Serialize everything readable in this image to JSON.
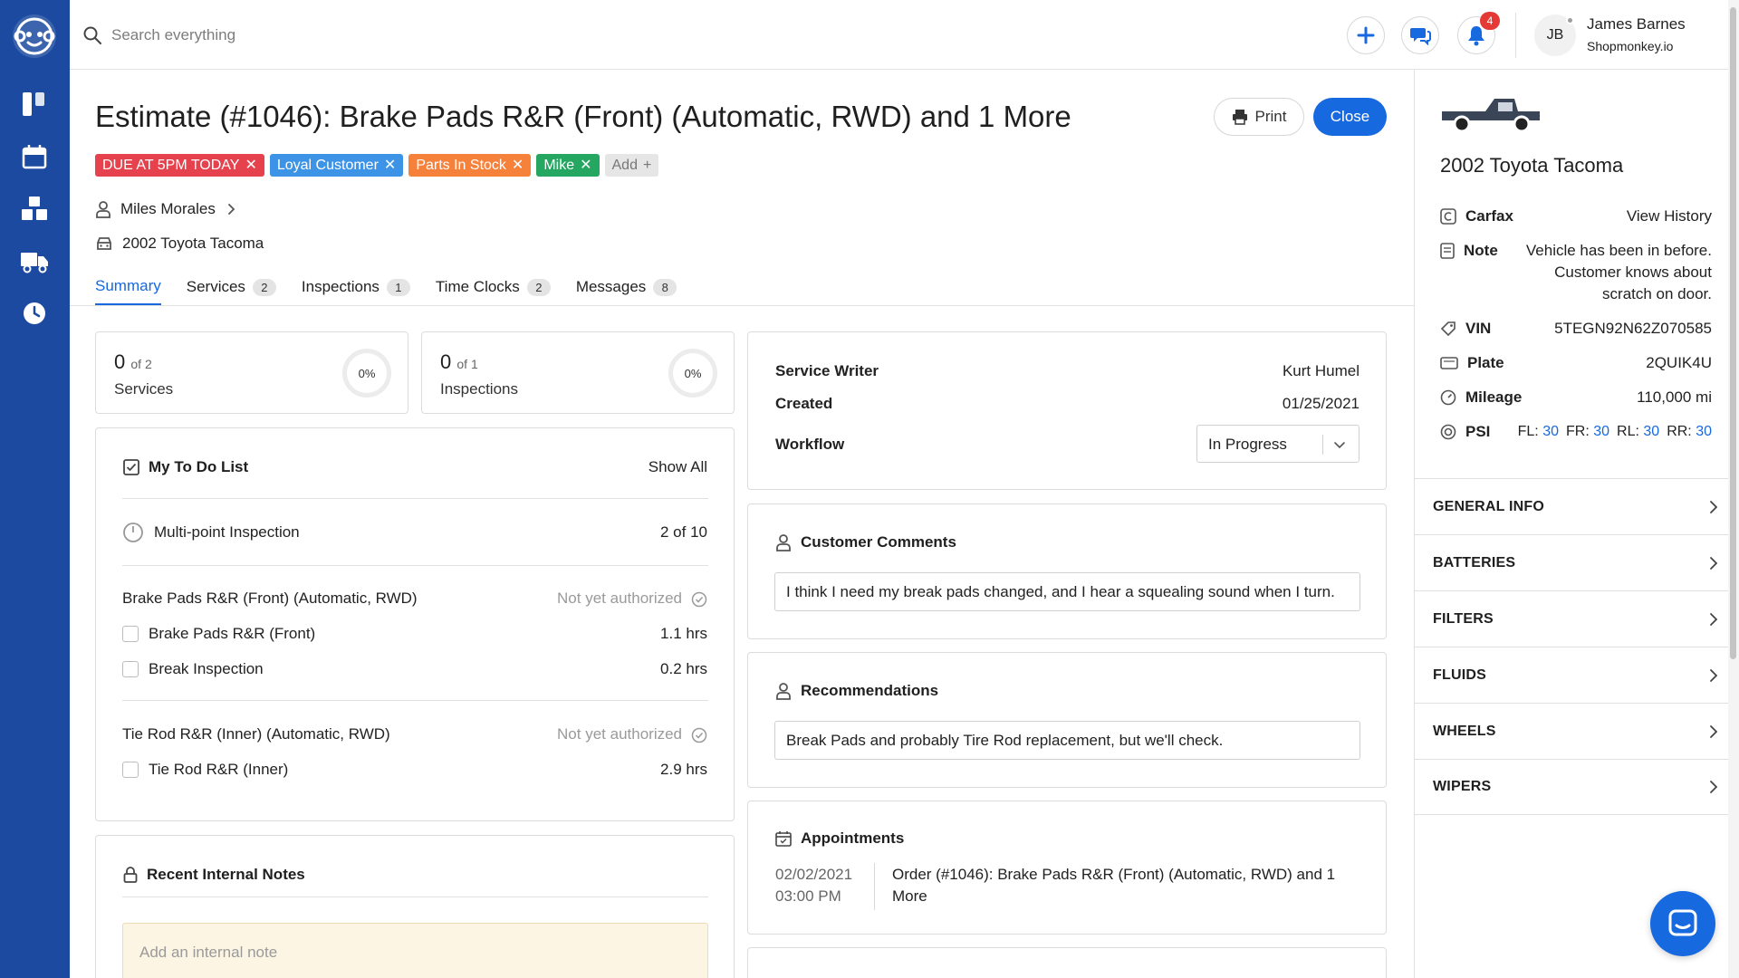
{
  "colors": {
    "sidebar": "#1b4aa0",
    "accent": "#1769e0",
    "tag_due": "#e5424d",
    "tag_loyal": "#3d94e6",
    "tag_parts": "#f5813b",
    "tag_tech": "#25a661"
  },
  "search": {
    "placeholder": "Search everything"
  },
  "topbar": {
    "notifications_count": "4"
  },
  "user": {
    "initials": "JB",
    "name": "James Barnes",
    "org": "Shopmonkey.io"
  },
  "page": {
    "title": "Estimate (#1046): Brake Pads R&R (Front) (Automatic, RWD) and 1 More",
    "print_label": "Print",
    "close_label": "Close"
  },
  "tags": [
    {
      "label": "DUE AT 5PM TODAY",
      "color": "#e5424d"
    },
    {
      "label": "Loyal Customer",
      "color": "#3d94e6"
    },
    {
      "label": "Parts In Stock",
      "color": "#f5813b"
    },
    {
      "label": "Mike",
      "color": "#25a661"
    }
  ],
  "tag_add_label": "Add",
  "customer": {
    "name": "Miles Morales",
    "vehicle": "2002 Toyota Tacoma"
  },
  "tabs": [
    {
      "label": "Summary",
      "count": ""
    },
    {
      "label": "Services",
      "count": "2"
    },
    {
      "label": "Inspections",
      "count": "1"
    },
    {
      "label": "Time Clocks",
      "count": "2"
    },
    {
      "label": "Messages",
      "count": "8"
    }
  ],
  "stats": {
    "services": {
      "done": "0",
      "of": "of 2",
      "label": "Services",
      "percent": "0%"
    },
    "inspections": {
      "done": "0",
      "of": "of 1",
      "label": "Inspections",
      "percent": "0%"
    }
  },
  "todo": {
    "title": "My To Do List",
    "show_all": "Show All",
    "mpi_label": "Multi-point Inspection",
    "mpi_count": "2 of 10",
    "groups": [
      {
        "title": "Brake Pads R&R (Front) (Automatic, RWD)",
        "status": "Not yet authorized",
        "items": [
          {
            "label": "Brake Pads R&R (Front)",
            "hours": "1.1 hrs"
          },
          {
            "label": "Break Inspection",
            "hours": "0.2 hrs"
          }
        ]
      },
      {
        "title": "Tie Rod R&R (Inner) (Automatic, RWD)",
        "status": "Not yet authorized",
        "items": [
          {
            "label": "Tie Rod R&R (Inner)",
            "hours": "2.9 hrs"
          }
        ]
      }
    ]
  },
  "notes": {
    "title": "Recent Internal Notes",
    "placeholder": "Add an internal note"
  },
  "details": {
    "service_writer_label": "Service Writer",
    "service_writer": "Kurt Humel",
    "created_label": "Created",
    "created": "01/25/2021",
    "workflow_label": "Workflow",
    "workflow": "In Progress"
  },
  "comments": {
    "title": "Customer Comments",
    "text": "I think I need my break pads changed, and I hear a squealing sound when I turn."
  },
  "recommendations": {
    "title": "Recommendations",
    "text": "Break Pads and probably Tire Rod replacement, but we'll check."
  },
  "appointments": {
    "title": "Appointments",
    "items": [
      {
        "date": "02/02/2021",
        "time": "03:00 PM",
        "line1": "Order (#1046): Brake Pads R&R (Front) (Automatic, RWD) and 1",
        "line2": "More"
      }
    ]
  },
  "vehicle": {
    "title": "2002 Toyota Tacoma",
    "carfax_label": "Carfax",
    "carfax_link": "View History",
    "note_label": "Note",
    "note_lines": [
      "Vehicle has been in before.",
      "Customer knows about",
      "scratch on door."
    ],
    "vin_label": "VIN",
    "vin": "5TEGN92N62Z070585",
    "plate_label": "Plate",
    "plate": "2QUIK4U",
    "mileage_label": "Mileage",
    "mileage": "110,000 mi",
    "psi_label": "PSI",
    "psi": [
      {
        "pos": "FL:",
        "val": "30"
      },
      {
        "pos": "FR:",
        "val": "30"
      },
      {
        "pos": "RL:",
        "val": "30"
      },
      {
        "pos": "RR:",
        "val": "30"
      }
    ]
  },
  "sections": [
    "GENERAL INFO",
    "BATTERIES",
    "FILTERS",
    "FLUIDS",
    "WHEELS",
    "WIPERS"
  ],
  "icons": [
    "monkey-logo-icon",
    "board-icon",
    "calendar-icon",
    "inventory-icon",
    "truck-icon",
    "clock-icon",
    "search-icon",
    "plus-icon",
    "chat-icon",
    "bell-icon",
    "chevron-down-icon",
    "printer-icon",
    "person-icon",
    "car-icon",
    "checkbox-icon",
    "timer-icon",
    "check-circle-icon",
    "lock-icon",
    "calendar-small-icon",
    "carfax-icon",
    "note-icon",
    "vin-tag-icon",
    "plate-icon",
    "gauge-icon",
    "tire-icon",
    "chevron-right-icon",
    "messenger-icon"
  ]
}
